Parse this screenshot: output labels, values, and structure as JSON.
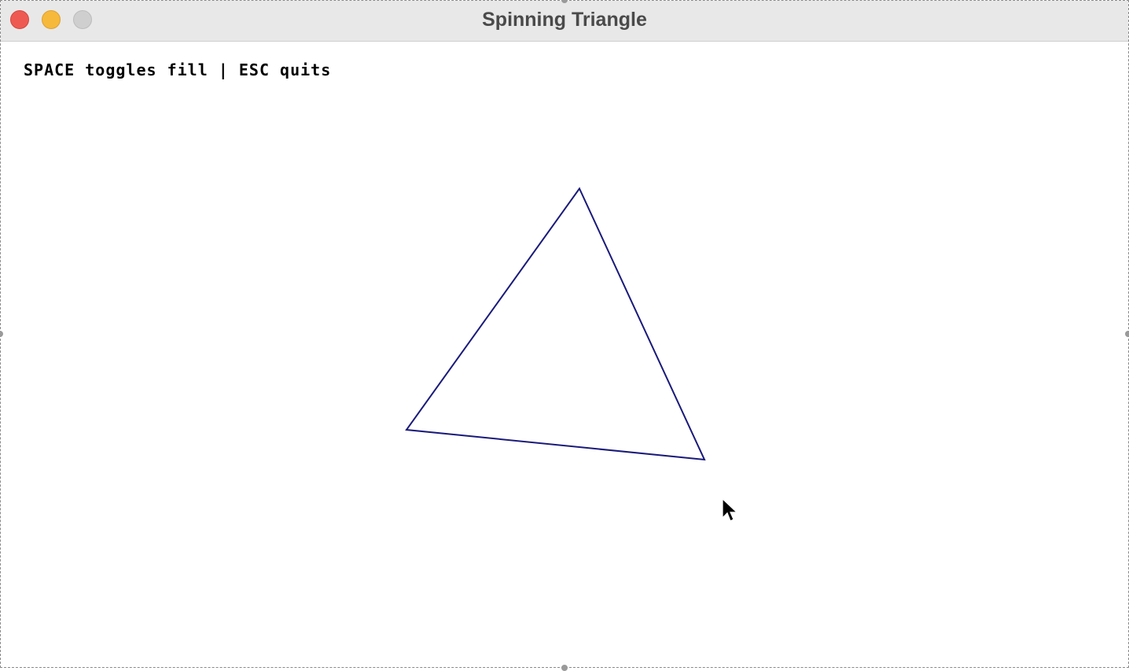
{
  "window": {
    "title": "Spinning Triangle",
    "buttons": {
      "close": "close-icon",
      "minimize": "minimize-icon",
      "zoom": "zoom-icon"
    }
  },
  "canvas": {
    "hint_text": "SPACE toggles fill | ESC quits",
    "background": "#ffffff",
    "triangle": {
      "stroke": "#1a1a7a",
      "filled": false
    },
    "cursor": "arrow-cursor-icon"
  }
}
